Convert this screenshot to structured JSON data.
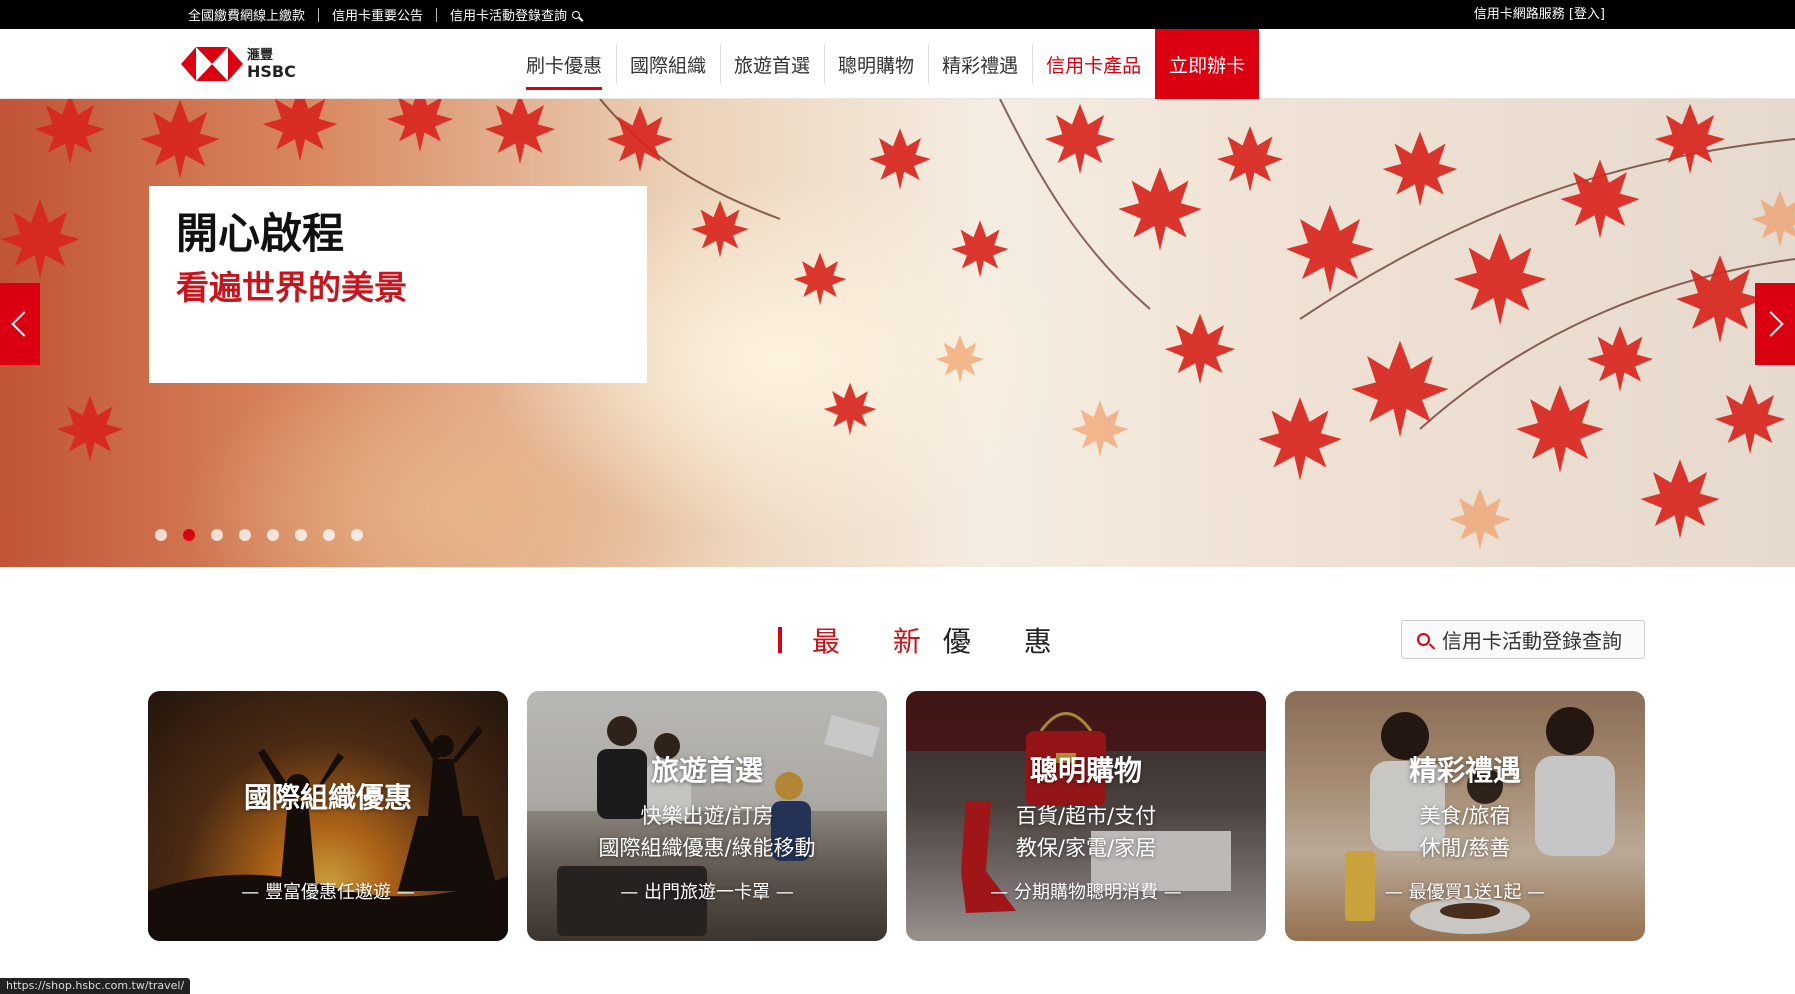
{
  "topbar": {
    "links": [
      "全國繳費網線上繳款",
      "信用卡重要公告",
      "信用卡活動登錄查詢"
    ],
    "right_text": "信用卡網路服務 [登入]"
  },
  "logo": {
    "cn": "滙豐",
    "en": "HSBC"
  },
  "nav": {
    "items": [
      "刷卡優惠",
      "國際組織",
      "旅遊首選",
      "聰明購物",
      "精彩禮遇",
      "信用卡產品",
      "立即辦卡"
    ],
    "active_index": 0
  },
  "hero": {
    "title": "開心啟程",
    "subtitle": "看遍世界的美景",
    "slide_count": 8,
    "active_slide": 1
  },
  "section": {
    "title_part1": "最 新",
    "title_part2": "優 惠",
    "register_button": "信用卡活動登錄查詢"
  },
  "cards": [
    {
      "title": "國際組織優惠",
      "lines": [],
      "tag": "— 豐富優惠任遨遊 —"
    },
    {
      "title": "旅遊首選",
      "lines": [
        "快樂出遊/訂房",
        "國際組織優惠/綠能移動"
      ],
      "tag": "— 出門旅遊一卡罩 —"
    },
    {
      "title": "聰明購物",
      "lines": [
        "百貨/超市/支付",
        "教保/家電/家居"
      ],
      "tag": "— 分期購物聰明消費 —"
    },
    {
      "title": "精彩禮遇",
      "lines": [
        "美食/旅宿",
        "休閒/慈善"
      ],
      "tag": "— 最優買1送1起 —"
    }
  ],
  "status_url": "https://shop.hsbc.com.tw/travel/",
  "colors": {
    "brand_red": "#db0011",
    "topbar": "#000000"
  }
}
